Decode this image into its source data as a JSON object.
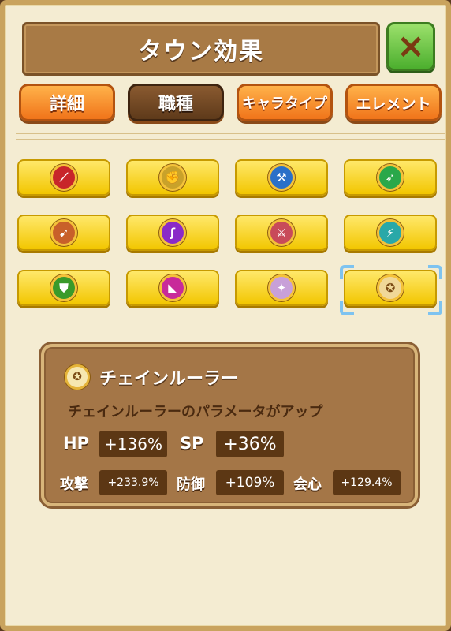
{
  "title": "タウン効果",
  "close_icon": "×",
  "tabs": [
    {
      "label": "詳細",
      "active": false
    },
    {
      "label": "職種",
      "active": true
    },
    {
      "label": "キャラタイプ",
      "active": false
    },
    {
      "label": "エレメント",
      "active": false
    }
  ],
  "job_buttons": [
    {
      "icon": "spear-icon",
      "color": "#c8252a"
    },
    {
      "icon": "fist-icon",
      "color": "#c9a22a"
    },
    {
      "icon": "axe-icon",
      "color": "#2a70c8"
    },
    {
      "icon": "arrow-icon",
      "color": "#2aa84a"
    },
    {
      "icon": "bow-icon",
      "color": "#c8602a"
    },
    {
      "icon": "staff-icon",
      "color": "#8a2ac8"
    },
    {
      "icon": "dual-blade-icon",
      "color": "#c84a5a"
    },
    {
      "icon": "blade-icon",
      "color": "#2aa8a8"
    },
    {
      "icon": "shield-icon",
      "color": "#3a9a2a"
    },
    {
      "icon": "boot-icon",
      "color": "#c82a9a"
    },
    {
      "icon": "magic-tome-icon",
      "color": "#c8a0d8"
    },
    {
      "icon": "chain-ruler-icon",
      "color": "#f0d898"
    }
  ],
  "selected_index": 11,
  "info": {
    "name": "チェインルーラー",
    "description": "チェインルーラーのパラメータがアップ",
    "stats": {
      "hp_label": "HP",
      "hp_value": "+136%",
      "sp_label": "SP",
      "sp_value": "+36%",
      "atk_label": "攻撃",
      "atk_value": "+233.9%",
      "def_label": "防御",
      "def_value": "+109%",
      "crit_label": "会心",
      "crit_value": "+129.4%"
    }
  }
}
